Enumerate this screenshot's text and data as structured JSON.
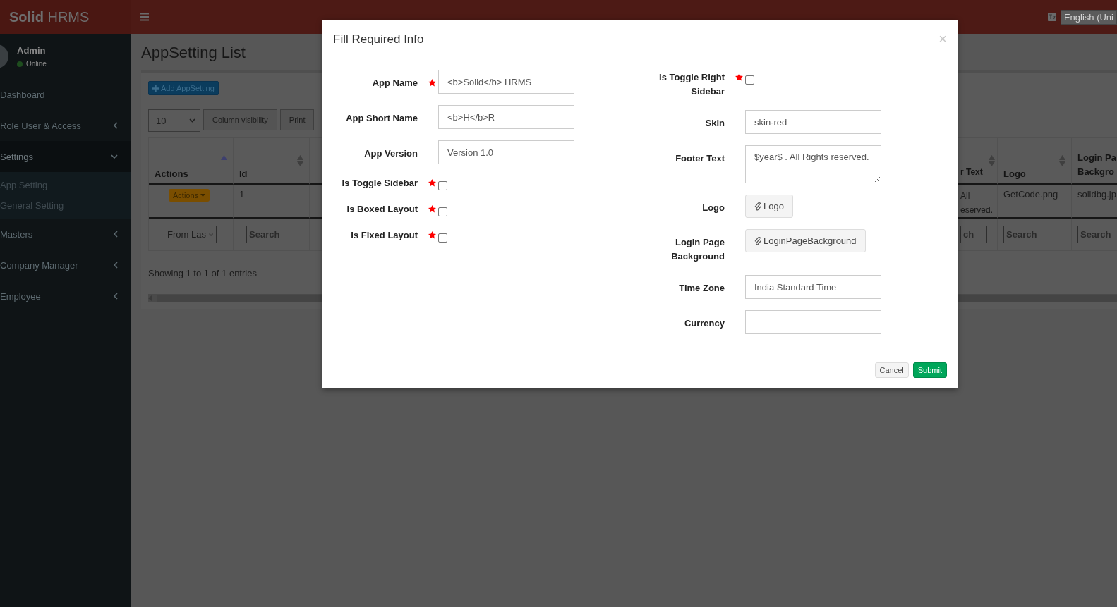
{
  "header": {
    "brand": "**Solid** HRMS",
    "language": "English (Uni"
  },
  "sidebar": {
    "user": {
      "name": "Admin",
      "status": "Online"
    },
    "items": [
      {
        "label": "Dashboard",
        "kind": "link",
        "expanded": false
      },
      {
        "label": "Role User & Access",
        "kind": "tree",
        "expanded": false
      },
      {
        "label": "Settings",
        "kind": "tree",
        "expanded": true,
        "children": [
          {
            "label": "App Setting"
          },
          {
            "label": "General Setting"
          }
        ]
      },
      {
        "label": "Masters",
        "kind": "tree",
        "expanded": false
      },
      {
        "label": "Company Manager",
        "kind": "tree",
        "expanded": false
      },
      {
        "label": "Employee",
        "kind": "tree",
        "expanded": false
      }
    ]
  },
  "page": {
    "title": "AppSetting List",
    "add_button": "Add AppSetting",
    "page_length": "10",
    "buttons": [
      "Column visibility",
      "Print"
    ],
    "table": {
      "left_columns": [
        {
          "label": "Actions",
          "kind": "sorted"
        },
        {
          "label": "Id",
          "kind": "sortable"
        }
      ],
      "right_columns": [
        {
          "label": "r Text",
          "kind": "sortable"
        },
        {
          "label": "Logo",
          "kind": "sortable"
        },
        {
          "label": "Login Pa Backgro",
          "kind": "plain"
        }
      ],
      "row": {
        "action": "Actions",
        "left_cells": [
          "1"
        ],
        "right_cells": [
          "All eserved.",
          "GetCode.png",
          "solidbg.jp"
        ]
      },
      "left_filters": [
        {
          "kind": "select",
          "value": "From Las"
        },
        {
          "kind": "search",
          "placeholder": "Search"
        }
      ],
      "right_filters": [
        {
          "kind": "search",
          "placeholder": "ch"
        },
        {
          "kind": "search",
          "placeholder": "Search"
        },
        {
          "kind": "search",
          "placeholder": "Search"
        }
      ]
    },
    "info": "Showing 1 to 1 of 1 entries"
  },
  "modal": {
    "title": "Fill Required Info",
    "close": "×",
    "left_fields": [
      {
        "label": "App Name",
        "kind": "text",
        "required": true,
        "value": "<b>Solid</b> HRMS"
      },
      {
        "label": "App Short Name",
        "kind": "text",
        "required": false,
        "value": "<b>H</b>R"
      },
      {
        "label": "App Version",
        "kind": "text",
        "required": false,
        "value": "Version 1.0"
      },
      {
        "label": "Is Toggle Sidebar",
        "kind": "checkbox",
        "required": true,
        "checked": false
      },
      {
        "label": "Is Boxed Layout",
        "kind": "checkbox",
        "required": true,
        "checked": false
      },
      {
        "label": "Is Fixed Layout",
        "kind": "checkbox",
        "required": true,
        "checked": false
      }
    ],
    "right_fields": [
      {
        "label": "Is Toggle Right Sidebar",
        "kind": "checkbox",
        "required": true,
        "checked": false
      },
      {
        "label": "Skin",
        "kind": "text",
        "required": false,
        "value": "skin-red"
      },
      {
        "label": "Footer Text",
        "kind": "textarea",
        "required": false,
        "value": "$year$ . All Rights reserved."
      },
      {
        "label": "Logo",
        "kind": "file",
        "required": false,
        "button": "Logo"
      },
      {
        "label": "Login Page Background",
        "kind": "file",
        "required": false,
        "button": "LoginPageBackground"
      },
      {
        "label": "Time Zone",
        "kind": "text",
        "required": false,
        "value": "India Standard Time"
      },
      {
        "label": "Currency",
        "kind": "text",
        "required": false
      }
    ],
    "buttons": [
      {
        "label": "Cancel",
        "kind": "default"
      },
      {
        "label": "Submit",
        "kind": "primary"
      }
    ]
  }
}
